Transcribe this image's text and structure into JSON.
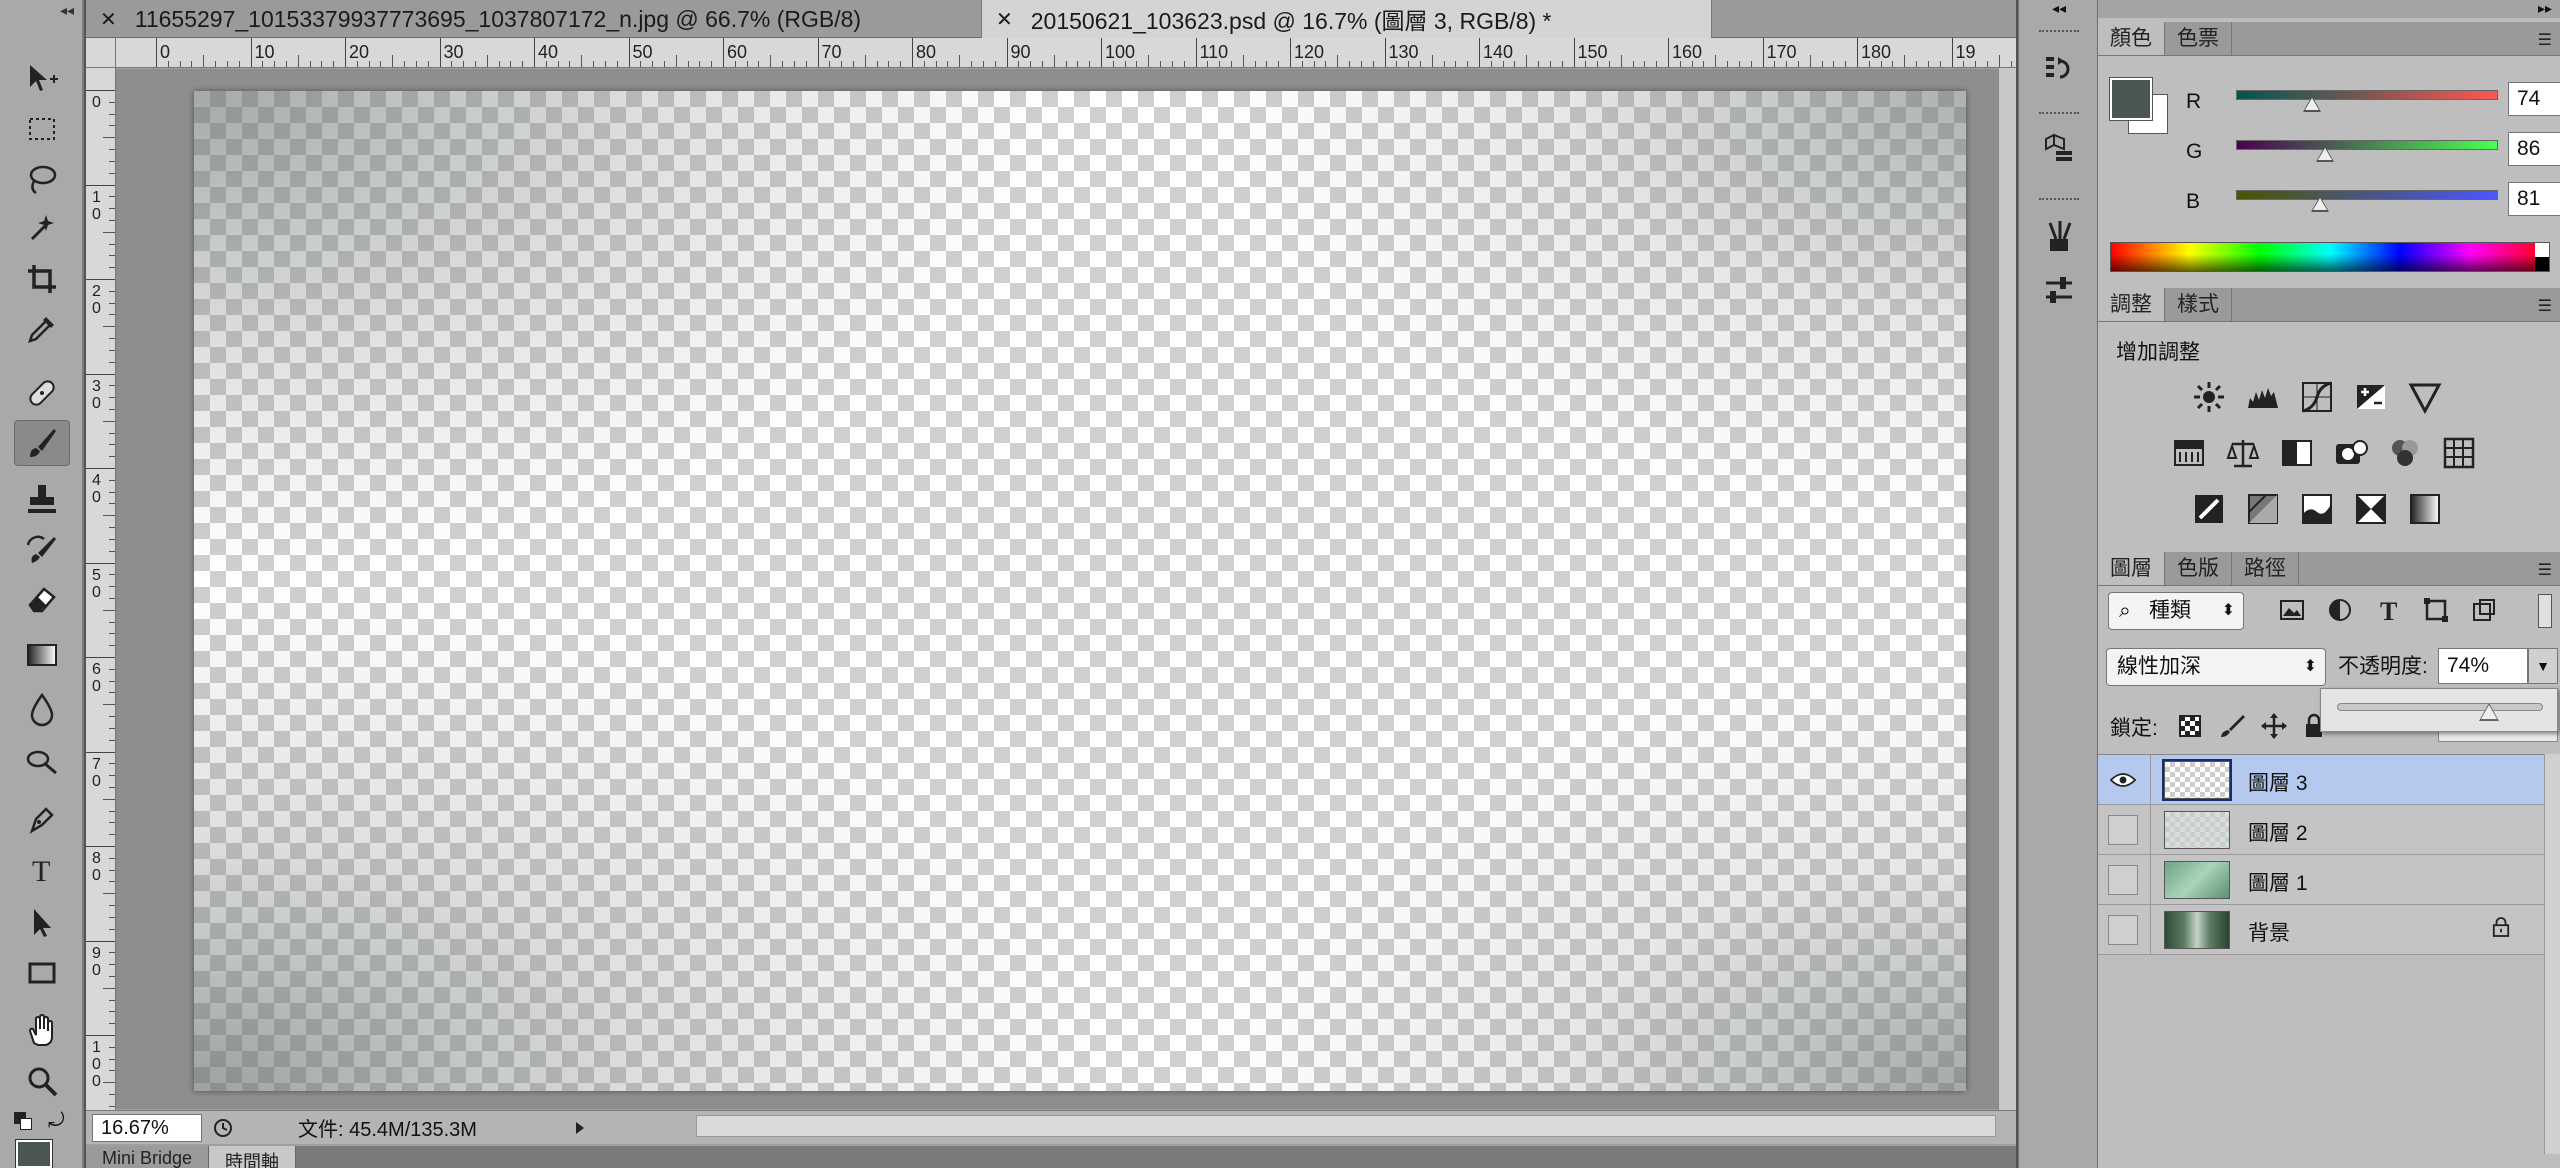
{
  "document_tabs": [
    {
      "label": "11655297_10153379937773695_1037807172_n.jpg @ 66.7% (RGB/8)",
      "active": false
    },
    {
      "label": "20150621_103623.psd @ 16.7% (圖層 3, RGB/8) *",
      "active": true
    }
  ],
  "ruler": {
    "top": [
      "0",
      "10",
      "20",
      "30",
      "40",
      "50",
      "60",
      "70",
      "80",
      "90",
      "100",
      "110",
      "120",
      "130",
      "140",
      "150",
      "160",
      "170",
      "180",
      "19"
    ],
    "left": [
      "0",
      "10",
      "20",
      "30",
      "40",
      "50",
      "60",
      "70",
      "80",
      "90",
      "100"
    ]
  },
  "status": {
    "zoom": "16.67%",
    "doc_size": "文件: 45.4M/135.3M"
  },
  "bottom_tabs": [
    "Mini Bridge",
    "時間軸"
  ],
  "color_panel": {
    "tabs": [
      "顏色",
      "色票"
    ],
    "foreground": "#4a5651",
    "channels": [
      {
        "label": "R",
        "value": "74",
        "fraction": 0.29
      },
      {
        "label": "G",
        "value": "86",
        "fraction": 0.34
      },
      {
        "label": "B",
        "value": "81",
        "fraction": 0.32
      }
    ]
  },
  "adjustments_panel": {
    "tabs": [
      "調整",
      "樣式"
    ],
    "title": "增加調整"
  },
  "layers_panel": {
    "tabs": [
      "圖層",
      "色版",
      "路徑"
    ],
    "filter_kind": "種類",
    "blend_mode": "線性加深",
    "opacity_label": "不透明度:",
    "opacity_value": "74%",
    "opacity_fraction": 0.74,
    "lock_label": "鎖定:",
    "layers": [
      {
        "name": "圖層 3",
        "selected": true,
        "visible": true,
        "locked": false
      },
      {
        "name": "圖層 2",
        "selected": false,
        "visible": false,
        "locked": false
      },
      {
        "name": "圖層 1",
        "selected": false,
        "visible": false,
        "locked": false
      },
      {
        "name": "背景",
        "selected": false,
        "visible": false,
        "locked": true
      }
    ]
  },
  "colors": {
    "selection": "#b5c9ef",
    "panel_bg": "#bebebe"
  }
}
